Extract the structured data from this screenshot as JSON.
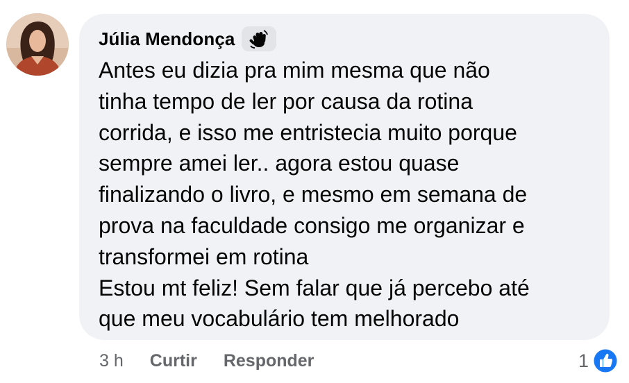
{
  "comment": {
    "author": {
      "name": "Júlia Mendonça",
      "badge_icon": "waving-hand-icon"
    },
    "body_lines": [
      "Antes eu dizia pra mim mesma que não",
      "tinha tempo de ler por causa da rotina",
      "corrida, e isso me entristecia muito porque",
      "sempre amei ler.. agora estou quase",
      "finalizando o livro, e mesmo em semana de",
      "prova na faculdade consigo me organizar e",
      "transformei em rotina",
      "Estou mt feliz! Sem falar que já percebo até",
      "que meu vocabulário tem melhorado"
    ],
    "timestamp": "3 h",
    "actions": {
      "like_label": "Curtir",
      "reply_label": "Responder"
    },
    "reactions": {
      "count": "1",
      "icon": "like-thumbs-up-icon",
      "color": "#1877f2"
    }
  },
  "colors": {
    "bubble_background": "#f0f2f5",
    "text_primary": "#050505",
    "text_secondary": "#65676b",
    "badge_background": "#e2e4e8"
  }
}
